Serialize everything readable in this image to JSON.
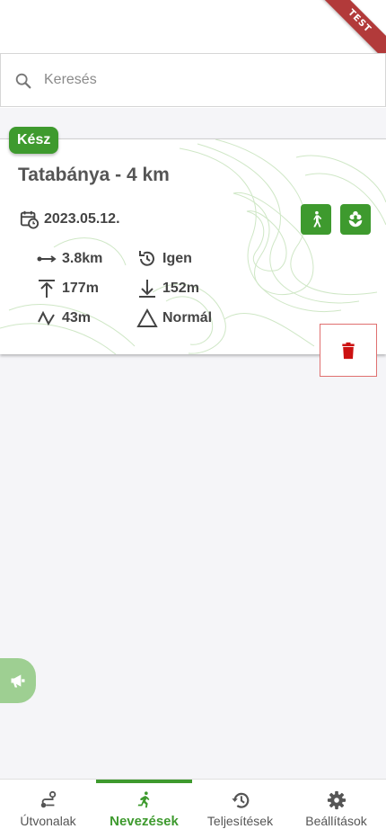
{
  "env_ribbon": "TEST",
  "search": {
    "placeholder": "Keresés",
    "icon": "search-icon"
  },
  "entry": {
    "status": "Kész",
    "title": "Tatabánya - 4 km",
    "date": "2023.05.12.",
    "tags": [
      "walking-icon",
      "flower-icon"
    ],
    "stats": {
      "distance": "3.8km",
      "circular": "Igen",
      "ascent": "177m",
      "descent": "152m",
      "elevation": "43m",
      "difficulty": "Normál"
    }
  },
  "nav": {
    "items": [
      {
        "label": "Útvonalak",
        "icon": "route-icon"
      },
      {
        "label": "Nevezések",
        "icon": "running-icon"
      },
      {
        "label": "Teljesítések",
        "icon": "history-icon"
      },
      {
        "label": "Beállítások",
        "icon": "gear-icon"
      }
    ],
    "active": "Nevezések"
  },
  "colors": {
    "accent": "#3e9a2e",
    "danger": "#cc1111",
    "ribbon": "#b23a3a",
    "feedback": "#9ecf92"
  }
}
